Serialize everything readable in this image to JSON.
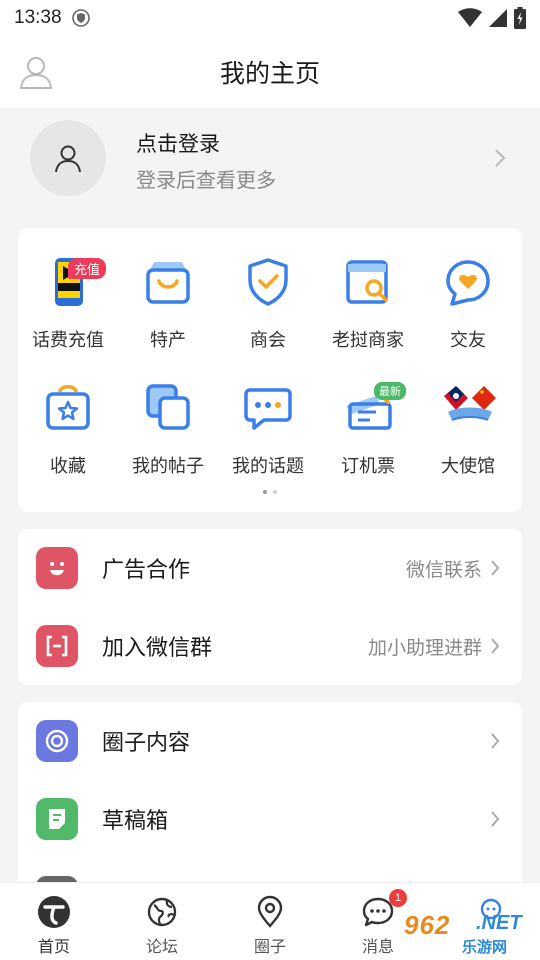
{
  "status_bar": {
    "time": "13:38"
  },
  "header": {
    "title": "我的主页"
  },
  "login": {
    "title": "点击登录",
    "subtitle": "登录后查看更多"
  },
  "grid": {
    "items": [
      {
        "label": "话费充值",
        "icon": "phone-recharge-icon",
        "badge": "充值"
      },
      {
        "label": "特产",
        "icon": "shopping-bag-icon"
      },
      {
        "label": "商会",
        "icon": "shield-check-icon"
      },
      {
        "label": "老挝商家",
        "icon": "store-search-icon"
      },
      {
        "label": "交友",
        "icon": "heart-chat-icon"
      },
      {
        "label": "收藏",
        "icon": "star-bag-icon"
      },
      {
        "label": "我的帖子",
        "icon": "copy-icon"
      },
      {
        "label": "我的话题",
        "icon": "chat-dots-icon"
      },
      {
        "label": "订机票",
        "icon": "ticket-icon",
        "badge": "最新"
      },
      {
        "label": "大使馆",
        "icon": "flags-icon"
      }
    ]
  },
  "list1": [
    {
      "label": "广告合作",
      "right": "微信联系",
      "icon": "smile-icon",
      "color": "#e05566"
    },
    {
      "label": "加入微信群",
      "right": "加小助理进群",
      "icon": "scan-icon",
      "color": "#e05566"
    }
  ],
  "list2": [
    {
      "label": "圈子内容",
      "icon": "disc-icon",
      "color": "#6a78e0"
    },
    {
      "label": "草稿箱",
      "icon": "draft-icon",
      "color": "#52b86a"
    }
  ],
  "bottom_nav": [
    {
      "label": "首页",
      "icon": "home-logo-icon"
    },
    {
      "label": "论坛",
      "icon": "globe-icon"
    },
    {
      "label": "圈子",
      "icon": "location-icon"
    },
    {
      "label": "消息",
      "icon": "message-icon",
      "badge": "1"
    },
    {
      "label": "",
      "icon": "chat-bubble-icon"
    }
  ],
  "watermark": {
    "num": "962",
    "net": ".NET",
    "sub": "乐游网"
  }
}
